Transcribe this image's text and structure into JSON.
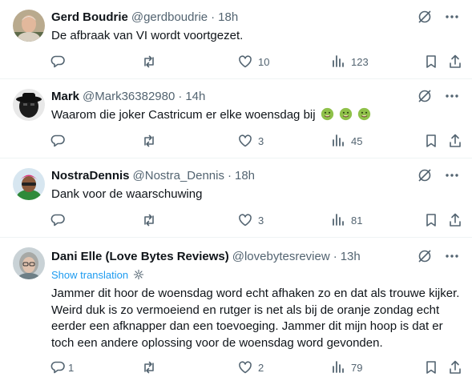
{
  "tweets": [
    {
      "name": "Gerd Boudrie",
      "handle": "@gerdboudrie",
      "dot": "·",
      "time": "18h",
      "text": "De afbraak van VI wordt voortgezet.",
      "replies": "",
      "likes": "10",
      "views": "123"
    },
    {
      "name": "Mark",
      "handle": "@Mark36382980",
      "dot": "·",
      "time": "14h",
      "text": "Waarom die joker Castricum er elke woensdag bij",
      "emoji": [
        "nauseated-face",
        "nauseated-face",
        "nauseated-face"
      ],
      "replies": "",
      "likes": "3",
      "views": "45"
    },
    {
      "name": "NostraDennis",
      "handle": "@Nostra_Dennis",
      "dot": "·",
      "time": "18h",
      "text": "Dank voor de waarschuwing",
      "replies": "",
      "likes": "3",
      "views": "81"
    },
    {
      "name": "Dani Elle (Love Bytes Reviews)",
      "handle": "@lovebytesreview",
      "dot": "·",
      "time": "13h",
      "translate_label": "Show translation",
      "text": "Jammer dit hoor de woensdag word echt afhaken zo en dat als trouwe kijker. Weird duk is zo vermoeiend en rutger is net als bij de oranje zondag echt eerder een afknapper dan een toevoeging. Jammer dit mijn hoop is dat er toch een andere oplossing voor de woensdag word gevonden.",
      "replies": "1",
      "likes": "2",
      "views": "79"
    }
  ],
  "icons": {
    "grok": "grok-icon",
    "more": "more-icon",
    "reply": "reply-icon",
    "retweet": "retweet-icon",
    "like": "like-icon",
    "views": "views-icon",
    "bookmark": "bookmark-icon",
    "share": "share-icon"
  },
  "colors": {
    "text": "#0f1419",
    "secondary": "#536471",
    "link": "#1d9bf0",
    "divider": "#eff3f4"
  }
}
